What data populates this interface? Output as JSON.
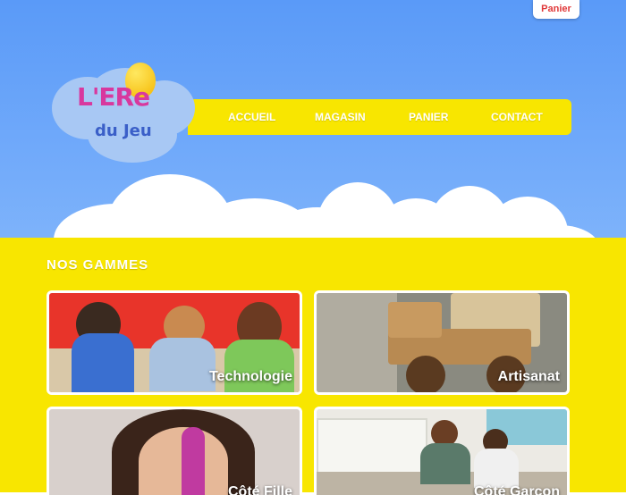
{
  "header": {
    "cart_tab": "Panier",
    "logo": {
      "line1": "L'ERe",
      "line2": "du Jeu"
    }
  },
  "nav": {
    "items": [
      {
        "label": "ACCUEIL"
      },
      {
        "label": "MAGASIN"
      },
      {
        "label": "PANIER"
      },
      {
        "label": "CONTACT"
      }
    ]
  },
  "main": {
    "section_title": "NOS GAMMES",
    "cards": [
      {
        "label": "Technologie"
      },
      {
        "label": "Artisanat"
      },
      {
        "label": "Côté Fille"
      },
      {
        "label": "Côté Garçon"
      }
    ]
  },
  "colors": {
    "sky": "#6aa6fa",
    "yellow": "#f8e600",
    "nav_text": "#ffffff",
    "cart_text": "#e0393a"
  }
}
